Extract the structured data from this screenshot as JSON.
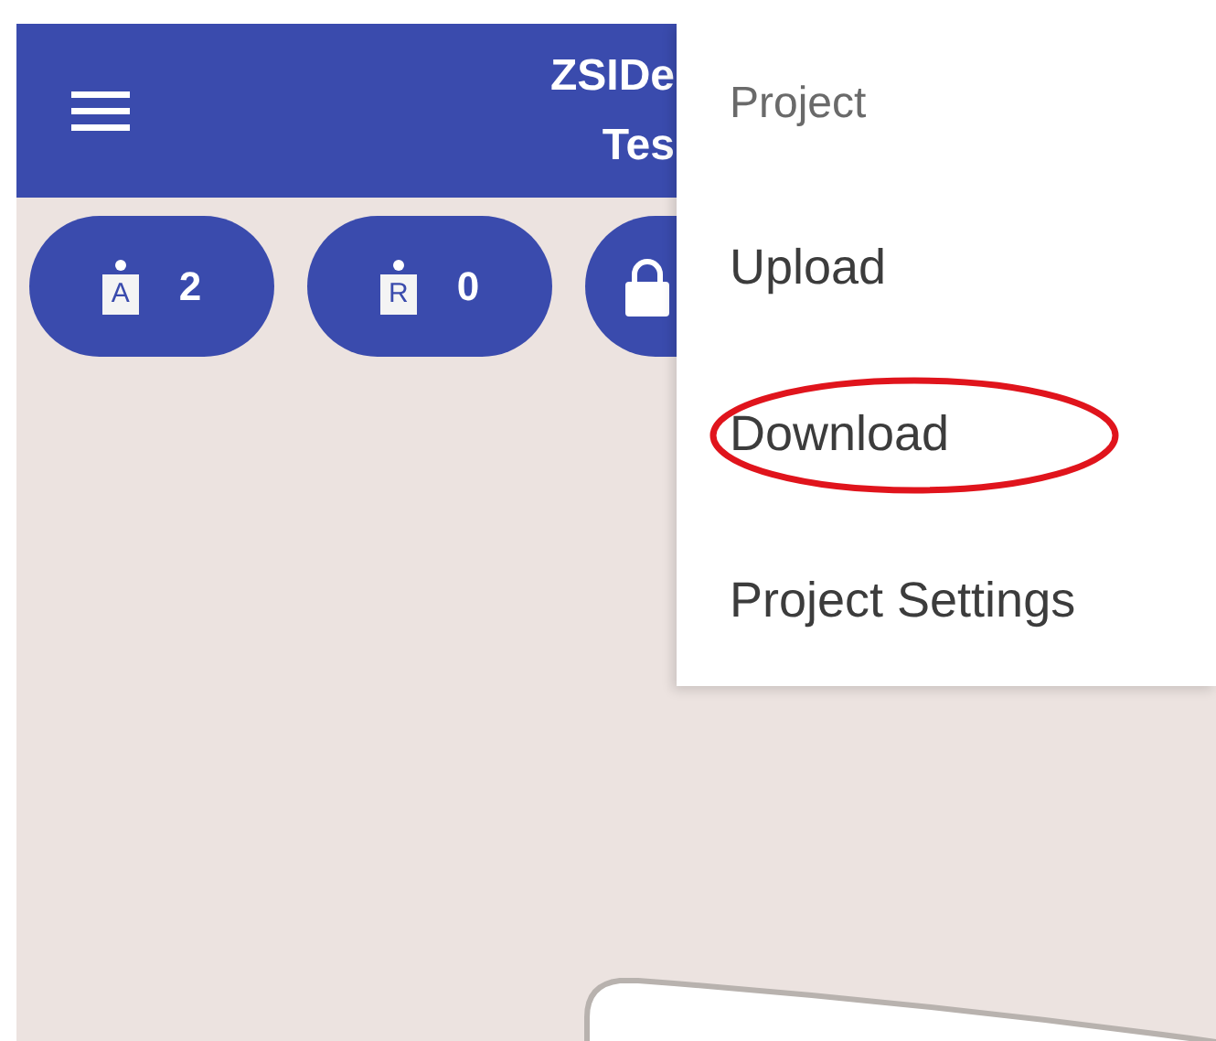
{
  "app_bar": {
    "title_lines": [
      "ZSIDe",
      "Tes"
    ]
  },
  "counters": [
    {
      "kind": "tag",
      "letter": "A",
      "count": "2"
    },
    {
      "kind": "tag",
      "letter": "R",
      "count": "0"
    },
    {
      "kind": "lock"
    }
  ],
  "menu": {
    "items": [
      {
        "label": "Project",
        "kind": "header",
        "circled": false
      },
      {
        "label": "Upload",
        "kind": "item",
        "circled": false
      },
      {
        "label": "Download",
        "kind": "item",
        "circled": true
      },
      {
        "label": "Project Settings",
        "kind": "item",
        "circled": false
      }
    ]
  }
}
